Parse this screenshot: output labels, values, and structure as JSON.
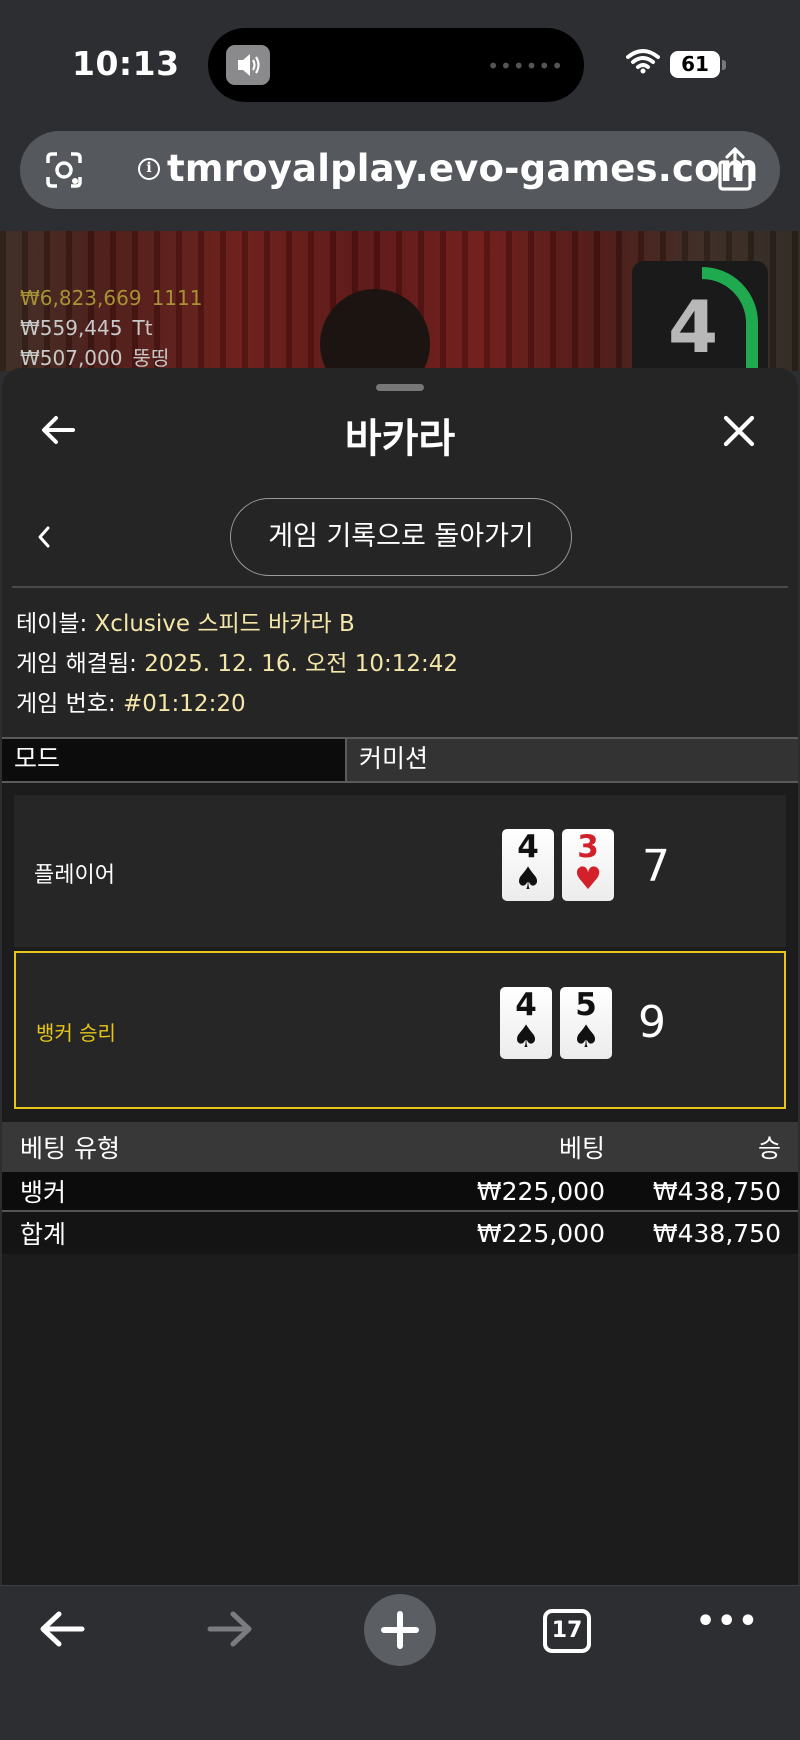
{
  "status_bar": {
    "time": "10:13",
    "battery": "61"
  },
  "browser": {
    "url": "tmroyalplay.evo-games.com",
    "open_tabs": "17"
  },
  "video": {
    "leaderboard": [
      {
        "amount": "₩6,823,669",
        "name": "1111"
      },
      {
        "amount": "₩559,445",
        "name": "Tt"
      },
      {
        "amount": "₩507,000",
        "name": "뚱띵"
      }
    ],
    "timer": "4"
  },
  "panel": {
    "title": "바카라",
    "back_to_history": "게임 기록으로 돌아가기",
    "info": {
      "table_label": "테이블:",
      "table_value": "Xclusive 스피드 바카라 B",
      "resolved_label": "게임 해결됨:",
      "resolved_value": "2025. 12. 16. 오전 10:12:42",
      "number_label": "게임 번호:",
      "number_value": "#01:12:20"
    },
    "mode_label": "모드",
    "commission_label": "커미션",
    "player": {
      "label": "플레이어",
      "cards": [
        {
          "rank": "4",
          "suit": "♠"
        },
        {
          "rank": "3",
          "suit": "♥"
        }
      ],
      "score": "7"
    },
    "banker": {
      "label": "뱅커 승리",
      "cards": [
        {
          "rank": "4",
          "suit": "♠"
        },
        {
          "rank": "5",
          "suit": "♠"
        }
      ],
      "score": "9"
    },
    "bets": {
      "headers": {
        "type": "베팅 유형",
        "bet": "베팅",
        "win": "승"
      },
      "rows": [
        {
          "type": "뱅커",
          "bet": "₩225,000",
          "win": "₩438,750"
        }
      ],
      "total": {
        "type": "합계",
        "bet": "₩225,000",
        "win": "₩438,750"
      }
    }
  },
  "colors": {
    "banker_accent": "#e6c619",
    "red_suit": "#d3202a",
    "timer_green": "#1faa4f"
  }
}
